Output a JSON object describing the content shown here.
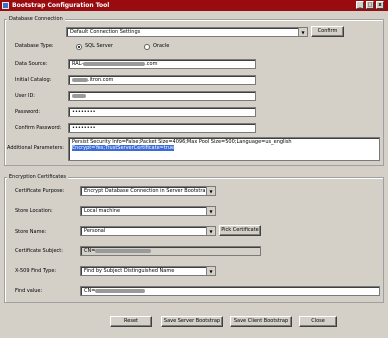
{
  "window": {
    "title": "Bootstrap Configuration Tool",
    "min": "_",
    "max": "□",
    "close": "x"
  },
  "db": {
    "legend": "Database Connection",
    "settings_value": "Default Connection Settings",
    "confirm_label": "Confirm",
    "db_type_label": "Database Type:",
    "radio_sql": "SQL Server",
    "radio_oracle": "Oracle",
    "data_source_label": "Data Source:",
    "data_source_prefix": "RAL-",
    "data_source_suffix": ".com",
    "catalog_label": "Initial Catalog:",
    "catalog_suffix": ".itron.com",
    "userid_label": "User ID:",
    "password_label": "Password:",
    "password_value": "••••••••",
    "confirm_pw_label": "Confirm Password:",
    "confirm_pw_value": "••••••••",
    "addl_label": "Additional Parameters:",
    "addl_value": "Persist Security Info=False;Packet Size=4096;Max Pool Size=500;Language=us_english",
    "addl_selected": "Encrypt=Yes;TrustServerCertificate=true"
  },
  "enc": {
    "legend": "Encryption Certificates",
    "purpose_label": "Certificate Purpose:",
    "purpose_value": "Encrypt Database Connection in Server Bootstrap",
    "location_label": "Store Location:",
    "location_value": "Local machine",
    "storename_label": "Store Name:",
    "storename_value": "Personal",
    "pick_label": "Pick Certificate",
    "subject_label": "Certificate Subject:",
    "subject_prefix": "CN=",
    "findtype_label": "X-509 Find Type:",
    "findtype_value": "Find by Subject Distinguished Name",
    "findvalue_label": "Find value:",
    "findvalue_prefix": "CN="
  },
  "actions": {
    "reset": "Reset",
    "save_server": "Save Server Bootstrap",
    "save_client": "Save Client Bootstrap",
    "close": "Close"
  }
}
